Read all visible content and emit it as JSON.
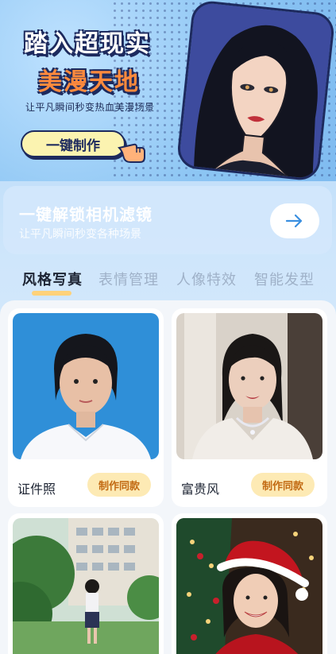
{
  "banner": {
    "title_line1": "踏入超现实",
    "title_line2": "美漫天地",
    "subtitle": "让平凡瞬间秒变热血美漫场景",
    "button_label": "一键制作"
  },
  "filter_card": {
    "title": "一键解锁相机滤镜",
    "subtitle": "让平凡瞬间秒变各种场景"
  },
  "tabs": [
    {
      "label": "风格写真",
      "active": true
    },
    {
      "label": "表情管理",
      "active": false
    },
    {
      "label": "人像特效",
      "active": false
    },
    {
      "label": "智能发型",
      "active": false
    }
  ],
  "cards": [
    {
      "name": "证件照",
      "button": "制作同款"
    },
    {
      "name": "富贵风",
      "button": "制作同款"
    },
    {
      "name": "",
      "button": ""
    },
    {
      "name": "",
      "button": ""
    }
  ],
  "colors": {
    "accent_orange": "#ff8a3d",
    "button_yellow": "#fdeab4",
    "navy": "#1d2a5e",
    "id_photo_blue": "#2f8fd8"
  }
}
